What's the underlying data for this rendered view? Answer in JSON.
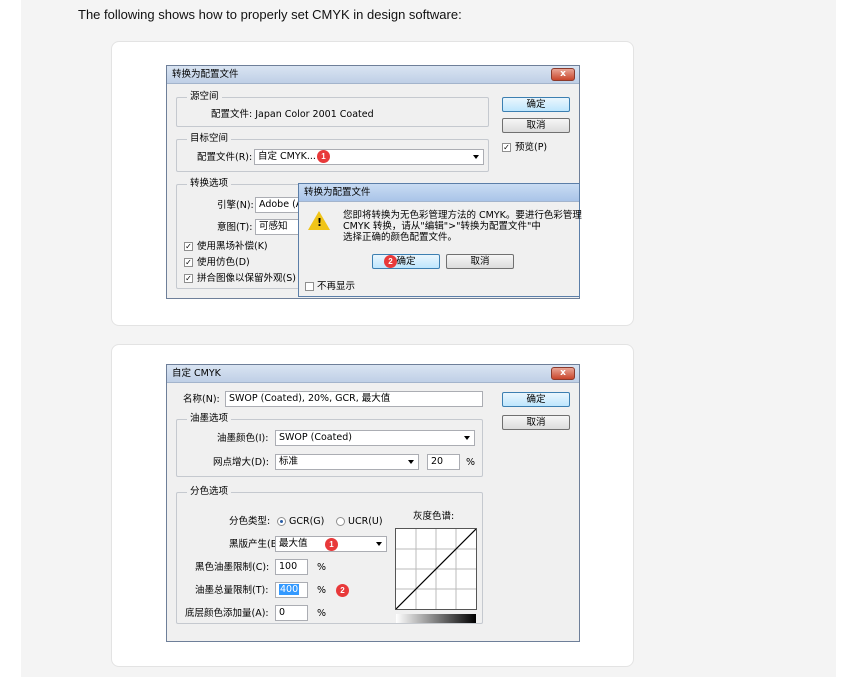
{
  "intro_text": "The following shows how to properly set CMYK in design software:",
  "dialog1": {
    "title": "转换为配置文件",
    "close": "x",
    "source_space": {
      "label": "源空间",
      "profile_label": "配置文件: Japan Color 2001 Coated"
    },
    "target_space": {
      "label": "目标空间",
      "profile_label": "配置文件(R):",
      "profile_value": "自定 CMYK..."
    },
    "convert_options": {
      "label": "转换选项",
      "engine_label": "引擎(N):",
      "engine_value": "Adobe (A",
      "intent_label": "意图(T):",
      "intent_value": "可感知",
      "black_point": "使用黑场补偿(K)",
      "dither": "使用仿色(D)",
      "flatten": "拼合图像以保留外观(S)"
    },
    "ok": "确定",
    "cancel": "取消",
    "preview": "预览(P)",
    "check": "✓",
    "badge": "1"
  },
  "alert": {
    "title": "转换为配置文件",
    "message_line1": "您即将转换为无色彩管理方法的 CMYK。要进行色彩管理",
    "message_line2": "CMYK 转换，请从\"编辑\">\"转换为配置文件\"中",
    "message_line3": "选择正确的颜色配置文件。",
    "ok": "确定",
    "cancel": "取消",
    "dont_show": "不再显示",
    "badge": "2",
    "warn_mark": "!"
  },
  "dialog2": {
    "title": "自定 CMYK",
    "close": "x",
    "name_label": "名称(N):",
    "name_value": "SWOP (Coated), 20%, GCR, 最大值",
    "ok": "确定",
    "cancel": "取消",
    "ink_options": {
      "label": "油墨选项",
      "ink_colors_label": "油墨颜色(I):",
      "ink_colors_value": "SWOP (Coated)",
      "dot_gain_label": "网点增大(D):",
      "dot_gain_value": "标准",
      "dot_gain_pct": "20",
      "pct": "%"
    },
    "separation": {
      "label": "分色选项",
      "type_label": "分色类型:",
      "gcr": "GCR(G)",
      "ucr": "UCR(U)",
      "gray_ramp": "灰度色谱:",
      "black_gen_label": "黑版产生(B):",
      "black_gen_value": "最大值",
      "black_ink_limit_label": "黑色油墨限制(C):",
      "black_ink_limit_value": "100",
      "total_ink_limit_label": "油墨总量限制(T):",
      "total_ink_limit_value": "400",
      "ucr_amount_label": "底层颜色添加量(A):",
      "ucr_amount_value": "0",
      "pct": "%"
    },
    "badge1": "1",
    "badge2": "2"
  },
  "colors": {
    "badge": "#e8393a",
    "page_bg": "#f4f4f4",
    "dialog_bg": "#f0f0f0"
  }
}
